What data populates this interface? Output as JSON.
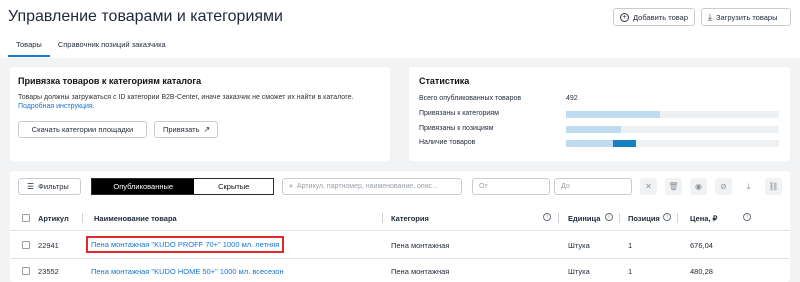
{
  "page": {
    "title": "Управление товарами и категориями",
    "add_product_label": "Добавить товар",
    "upload_products_label": "Загрузить товары"
  },
  "tabs": [
    {
      "label": "Товары",
      "active": true
    },
    {
      "label": "Справочник позиций заказчика",
      "active": false
    }
  ],
  "binding": {
    "title": "Привязка товаров к категориям каталога",
    "description": "Товары должны загружаться с ID категории B2B-Center, иначе заказчик не сможет их найти в каталоге.",
    "instruction_link": "Подробная инструкция.",
    "download_button": "Скачать категории площадки",
    "bind_button": "Привязать"
  },
  "stats": {
    "title": "Статистика",
    "rows": [
      {
        "label": "Всего опубликованных товаров",
        "value": "492"
      },
      {
        "label": "Привязаны к категориям",
        "fill": 0.44
      },
      {
        "label": "Привязаны к позициям",
        "fill": 0.26
      },
      {
        "label": "Наличие товаров",
        "fill": 0.33,
        "dark_fill_start": 0.22
      }
    ]
  },
  "toolbar": {
    "filters_label": "Фильтры",
    "published_label": "Опубликованные",
    "hidden_label": "Скрытые",
    "search_placeholder": "Артикул, партномер, наименование, опис...",
    "from_placeholder": "От",
    "to_placeholder": "До"
  },
  "table": {
    "headers": {
      "article": "Артикул",
      "name": "Наименование товара",
      "category": "Категория",
      "unit": "Единица",
      "position": "Позиция",
      "price": "Цена, ₽"
    },
    "rows": [
      {
        "article": "22941",
        "name": "Пена монтажная \"KUDO PROFF 70+\" 1000 мл. летняя",
        "category": "Пена монтажная",
        "unit": "Штука",
        "position": "1",
        "price": "676,04",
        "highlighted": true
      },
      {
        "article": "23552",
        "name": "Пена монтажная \"KUDO HOME 50+\" 1000 мл. всесезон",
        "category": "Пена монтажная",
        "unit": "Штука",
        "position": "1",
        "price": "480,28",
        "highlighted": false
      }
    ]
  },
  "colors": {
    "accent": "#1976d2",
    "highlight_border": "#e0282e",
    "bar_light": "#bfdbf0",
    "bar_dark": "#1780c4"
  }
}
